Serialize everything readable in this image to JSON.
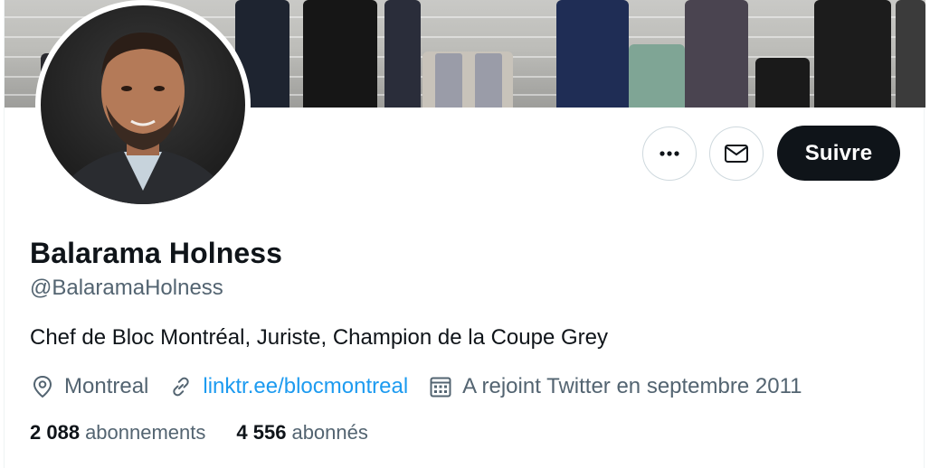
{
  "profile": {
    "name": "Balarama Holness",
    "handle": "@BalaramaHolness",
    "bio": "Chef de Bloc Montréal, Juriste, Champion de la Coupe Grey",
    "location": "Montreal",
    "link": "linktr.ee/blocmontreal",
    "joined": "A rejoint Twitter en septembre 2011"
  },
  "actions": {
    "more_icon": "more-dots-icon",
    "message_icon": "envelope-icon",
    "follow_label": "Suivre"
  },
  "stats": {
    "following_count": "2 088",
    "following_label": "abonnements",
    "followers_count": "4 556",
    "followers_label": "abonnés"
  },
  "colors": {
    "link": "#1d9bf0",
    "secondary_text": "#536471",
    "primary_text": "#0f1419",
    "follow_button": "#0f1419"
  }
}
